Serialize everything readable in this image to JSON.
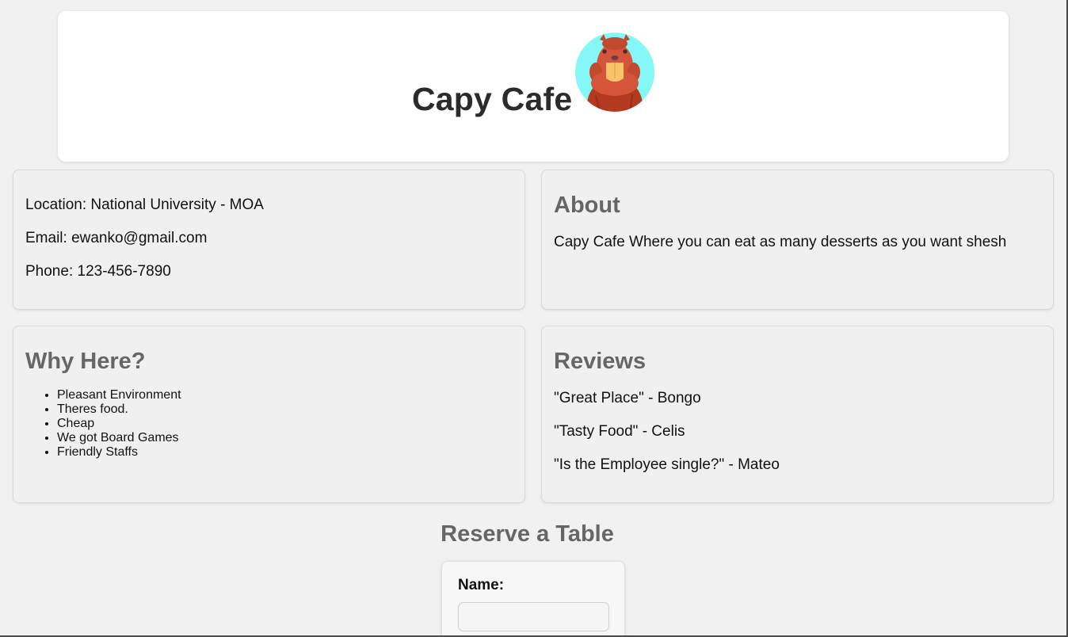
{
  "header": {
    "title": "Capy Cafe",
    "logo_icon": "capybara-logo-icon"
  },
  "contact": {
    "location": "Location: National University - MOA",
    "email": "Email: ewanko@gmail.com",
    "phone": "Phone: 123-456-7890"
  },
  "about": {
    "heading": "About",
    "text": "Capy Cafe Where you can eat as many desserts as you want shesh"
  },
  "why_here": {
    "heading": "Why Here?",
    "items": [
      "Pleasant Environment",
      "Theres food.",
      "Cheap",
      "We got Board Games",
      "Friendly Staffs"
    ]
  },
  "reviews": {
    "heading": "Reviews",
    "items": [
      "\"Great Place\" - Bongo",
      "\"Tasty Food\" - Celis",
      "\"Is the Employee single?\" - Mateo"
    ]
  },
  "reserve": {
    "heading": "Reserve a Table",
    "name_label": "Name:",
    "name_value": ""
  },
  "colors": {
    "page_background": "#f1f1f1",
    "card_background": "#f0f0f0",
    "heading_gray": "#666666",
    "title_dark": "#2b2b2b",
    "logo_circle": "#85f7f7",
    "logo_fur": "#d4553a"
  }
}
